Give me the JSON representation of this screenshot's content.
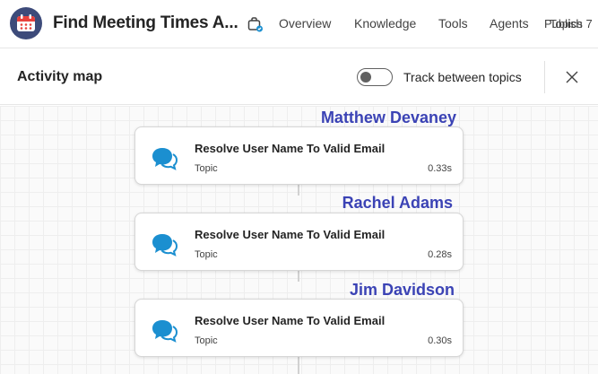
{
  "app": {
    "title": "Find Meeting Times A..."
  },
  "nav": {
    "items": [
      "Overview",
      "Knowledge",
      "Tools",
      "Agents"
    ],
    "overlap_a": "Publish",
    "overlap_b": "Topics 7"
  },
  "panel": {
    "title": "Activity map",
    "toggle_label": "Track between topics",
    "toggle_on": false
  },
  "activity": [
    {
      "user": "Matthew Devaney",
      "title": "Resolve User Name To Valid Email",
      "type": "Topic",
      "duration": "0.33s"
    },
    {
      "user": "Rachel Adams",
      "title": "Resolve User Name To Valid Email",
      "type": "Topic",
      "duration": "0.28s"
    },
    {
      "user": "Jim Davidson",
      "title": "Resolve User Name To Valid Email",
      "type": "Topic",
      "duration": "0.30s"
    }
  ],
  "colors": {
    "user_label": "#3b43b5",
    "icon_blue": "#1b8fd0",
    "app_icon_bg": "#3d4b7a"
  },
  "icons": {
    "app": "calendar-icon",
    "bag": "briefcase-icon",
    "close": "close-icon",
    "card": "chat-bubbles-icon"
  }
}
